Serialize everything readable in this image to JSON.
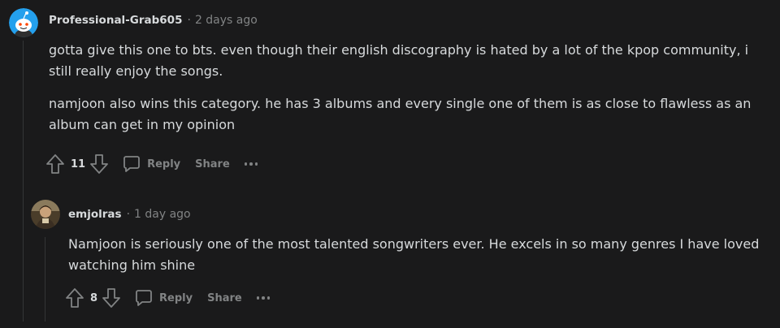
{
  "comments": [
    {
      "author": "Professional-Grab605",
      "separator": "·",
      "time": "2 days ago",
      "paragraphs": [
        "gotta give this one to bts. even though their english discography is hated by a lot of the kpop community, i still really enjoy the songs.",
        "namjoon also wins this category. he has 3 albums and every single one of them is as close to flawless as an album can get in my opinion"
      ],
      "score": "11",
      "reply_label": "Reply",
      "share_label": "Share",
      "avatar_color": "#24a0ed"
    },
    {
      "author": "emjolras",
      "separator": "·",
      "time": "1 day ago",
      "paragraphs": [
        "Namjoon is seriously one of the most talented songwriters ever. He excels in so many genres I have loved watching him shine"
      ],
      "score": "8",
      "reply_label": "Reply",
      "share_label": "Share",
      "avatar_color": "#6b5a3e"
    }
  ],
  "icons": {
    "upvote": "upvote-arrow-icon",
    "downvote": "downvote-arrow-icon",
    "reply": "comment-bubble-icon",
    "more": "more-dots-icon"
  },
  "colors": {
    "background": "#1a1a1b",
    "text": "#d7dadc",
    "muted": "#818384",
    "thread_line": "#343536"
  }
}
